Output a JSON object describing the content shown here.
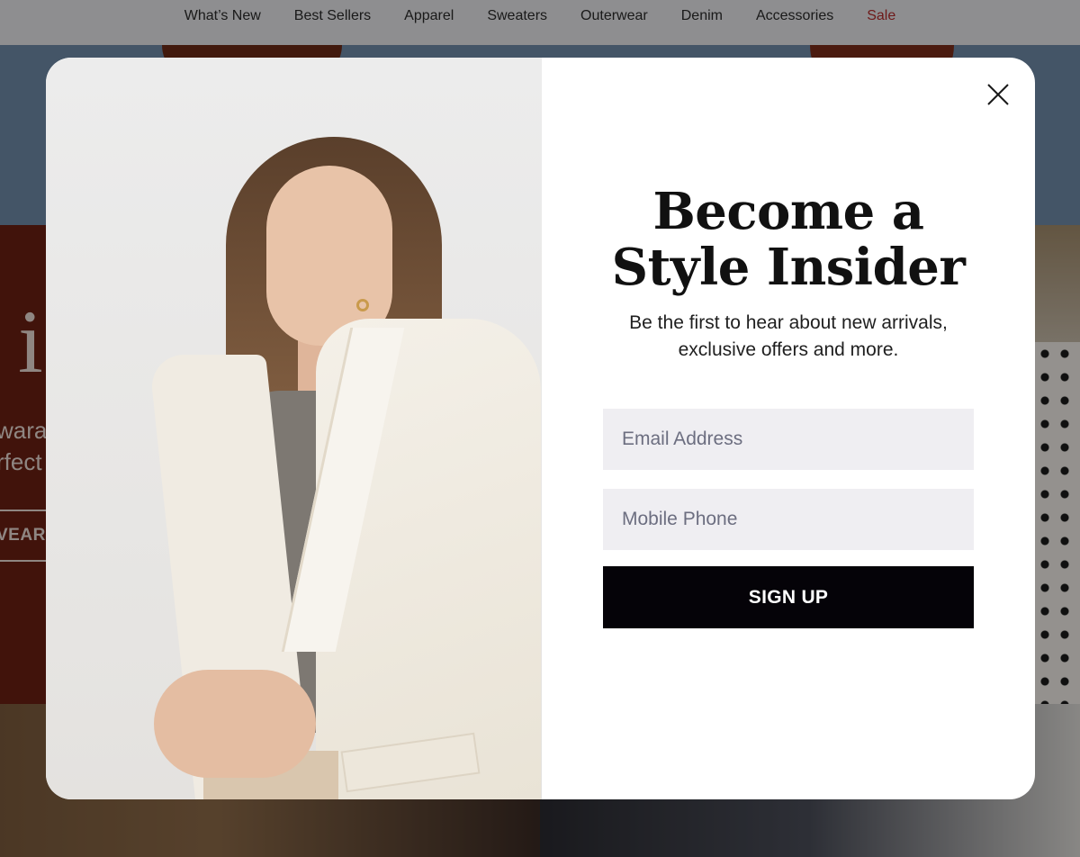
{
  "nav": {
    "items": [
      {
        "label": "What’s New"
      },
      {
        "label": "Best Sellers"
      },
      {
        "label": "Apparel"
      },
      {
        "label": "Sweaters"
      },
      {
        "label": "Outerwear"
      },
      {
        "label": "Denim"
      },
      {
        "label": "Accessories"
      },
      {
        "label": "Sale"
      }
    ],
    "sale_color": "#b22a2a"
  },
  "background_page": {
    "hero_letter": "i",
    "hero_line1": "wara",
    "hero_line2": "rfect",
    "hero_button": "VEAR"
  },
  "modal": {
    "headline_line1": "Become a",
    "headline_line2": "Style Insider",
    "subtext_line1": "Be the first to hear about new arrivals,",
    "subtext_line2": "exclusive offers and more.",
    "email_placeholder": "Email Address",
    "phone_placeholder": "Mobile Phone",
    "signup_label": "SIGN UP",
    "close_icon": "close-icon",
    "button_color": "#050308",
    "field_color": "#efeef2"
  }
}
